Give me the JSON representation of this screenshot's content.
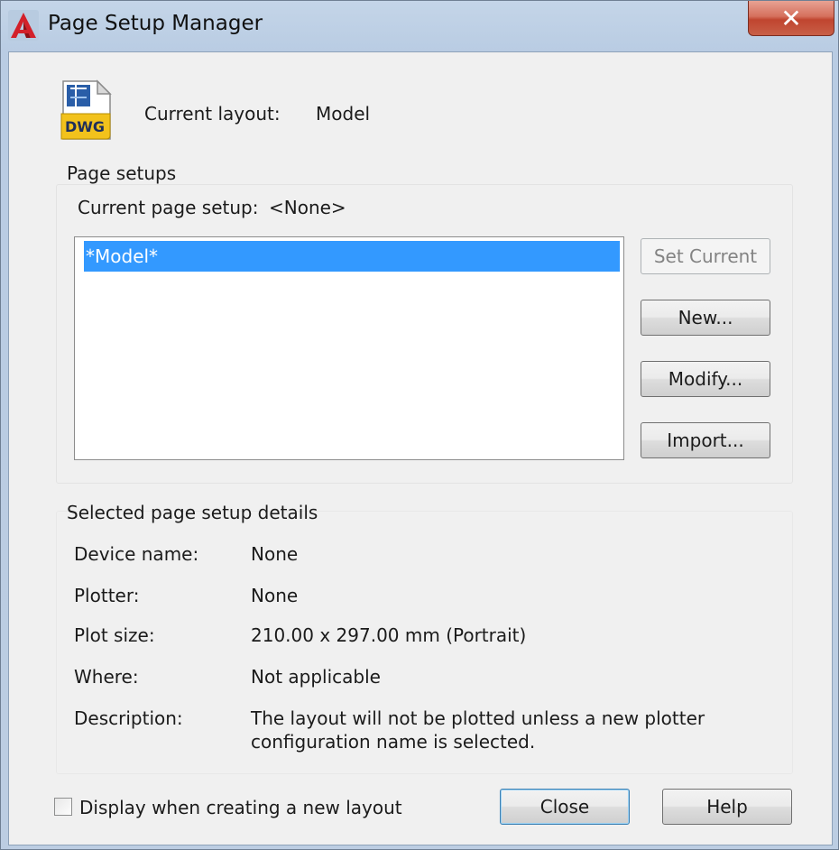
{
  "window": {
    "title": "Page Setup Manager",
    "close_glyph": "✕"
  },
  "header": {
    "current_layout_label": "Current layout:",
    "current_layout_value": "Model",
    "file_icon_text": "DWG"
  },
  "page_setups": {
    "group_title": "Page setups",
    "current_label": "Current page setup:",
    "current_value": "<None>",
    "items": [
      "*Model*"
    ],
    "selected_index": 0,
    "buttons": {
      "set_current": "Set Current",
      "new": "New...",
      "modify": "Modify...",
      "import": "Import..."
    }
  },
  "details": {
    "group_title": "Selected page setup details",
    "device_name_label": "Device name:",
    "device_name_value": "None",
    "plotter_label": "Plotter:",
    "plotter_value": "None",
    "plot_size_label": "Plot size:",
    "plot_size_value": "210.00 x 297.00 mm (Portrait)",
    "where_label": "Where:",
    "where_value": "Not applicable",
    "description_label": "Description:",
    "description_line1": "The layout will not be plotted unless a new plotter",
    "description_line2": "configuration name is selected."
  },
  "footer": {
    "checkbox_label": "Display when creating a new layout",
    "checkbox_checked": false,
    "close_button": "Close",
    "help_button": "Help"
  },
  "colors": {
    "selection": "#3399ff",
    "title_close": "#c7442f",
    "dwg_yellow": "#f2c21c"
  }
}
